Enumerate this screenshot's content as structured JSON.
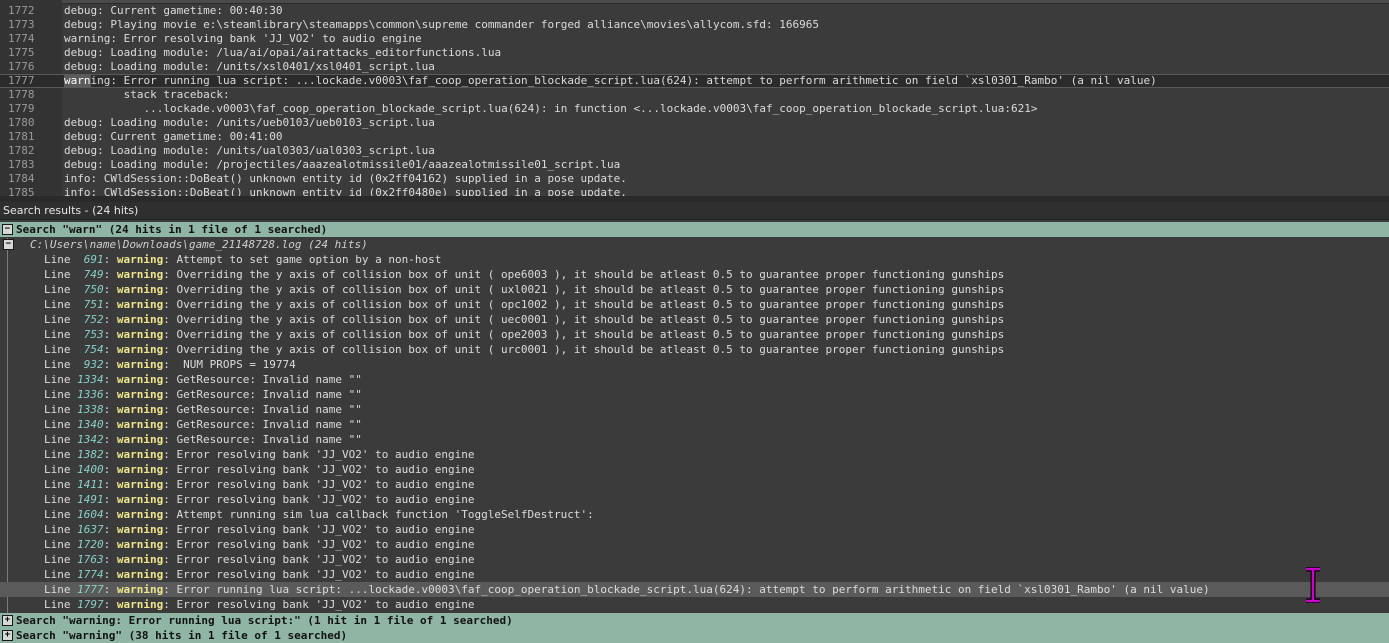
{
  "editor": {
    "lines": [
      {
        "num": "1772",
        "text": "debug: Current gametime: 00:40:30"
      },
      {
        "num": "1773",
        "text": "debug: Playing movie e:\\steamlibrary\\steamapps\\common\\supreme commander forged alliance\\movies\\allycom.sfd: 166965"
      },
      {
        "num": "1774",
        "text": "warning: Error resolving bank 'JJ_VO2' to audio engine"
      },
      {
        "num": "1775",
        "text": "debug: Loading module: /lua/ai/opai/airattacks_editorfunctions.lua"
      },
      {
        "num": "1776",
        "text": "debug: Loading module: /units/xsl0401/xsl0401_script.lua"
      },
      {
        "num": "1777",
        "hl": "warn",
        "text": "ing: Error running lua script: ...lockade.v0003\\faf_coop_operation_blockade_script.lua(624): attempt to perform arithmetic on field `xsl0301_Rambo' (a nil value)"
      },
      {
        "num": "1778",
        "text": "         stack traceback:"
      },
      {
        "num": "1779",
        "text": "            ...lockade.v0003\\faf_coop_operation_blockade_script.lua(624): in function <...lockade.v0003\\faf_coop_operation_blockade_script.lua:621>"
      },
      {
        "num": "1780",
        "text": "debug: Loading module: /units/ueb0103/ueb0103_script.lua"
      },
      {
        "num": "1781",
        "text": "debug: Current gametime: 00:41:00"
      },
      {
        "num": "1782",
        "text": "debug: Loading module: /units/ual0303/ual0303_script.lua"
      },
      {
        "num": "1783",
        "text": "debug: Loading module: /projectiles/aaazealotmissile01/aaazealotmissile01_script.lua"
      },
      {
        "num": "1784",
        "text": "info: CWldSession::DoBeat() unknown entity id (0x2ff04162) supplied in a pose update."
      },
      {
        "num": "1785",
        "text": "info: CWldSession::DoBeat() unknown entity id (0x2ff0480e) supplied in a pose update."
      }
    ]
  },
  "search_panel": {
    "header": "Search results - (24 hits)",
    "search_title": "Search \"warn\" (24 hits in 1 file of 1 searched)",
    "file": "C:\\Users\\name\\Downloads\\game_21148728.log (24 hits)",
    "line_word": "Line",
    "hits": [
      {
        "num": " 691",
        "kw": "warning",
        "text": ": Attempt to set game option by a non-host"
      },
      {
        "num": " 749",
        "kw": "warning",
        "text": ": Overriding the y axis of collision box of unit ( ope6003 ), it should be atleast 0.5 to guarantee proper functioning gunships"
      },
      {
        "num": " 750",
        "kw": "warning",
        "text": ": Overriding the y axis of collision box of unit ( uxl0021 ), it should be atleast 0.5 to guarantee proper functioning gunships"
      },
      {
        "num": " 751",
        "kw": "warning",
        "text": ": Overriding the y axis of collision box of unit ( opc1002 ), it should be atleast 0.5 to guarantee proper functioning gunships"
      },
      {
        "num": " 752",
        "kw": "warning",
        "text": ": Overriding the y axis of collision box of unit ( uec0001 ), it should be atleast 0.5 to guarantee proper functioning gunships"
      },
      {
        "num": " 753",
        "kw": "warning",
        "text": ": Overriding the y axis of collision box of unit ( ope2003 ), it should be atleast 0.5 to guarantee proper functioning gunships"
      },
      {
        "num": " 754",
        "kw": "warning",
        "text": ": Overriding the y axis of collision box of unit ( urc0001 ), it should be atleast 0.5 to guarantee proper functioning gunships"
      },
      {
        "num": " 932",
        "kw": "warning",
        "text": ":  NUM PROPS = 19774"
      },
      {
        "num": "1334",
        "kw": "warning",
        "text": ": GetResource: Invalid name \"\""
      },
      {
        "num": "1336",
        "kw": "warning",
        "text": ": GetResource: Invalid name \"\""
      },
      {
        "num": "1338",
        "kw": "warning",
        "text": ": GetResource: Invalid name \"\""
      },
      {
        "num": "1340",
        "kw": "warning",
        "text": ": GetResource: Invalid name \"\""
      },
      {
        "num": "1342",
        "kw": "warning",
        "text": ": GetResource: Invalid name \"\""
      },
      {
        "num": "1382",
        "kw": "warning",
        "text": ": Error resolving bank 'JJ_VO2' to audio engine"
      },
      {
        "num": "1400",
        "kw": "warning",
        "text": ": Error resolving bank 'JJ_VO2' to audio engine"
      },
      {
        "num": "1411",
        "kw": "warning",
        "text": ": Error resolving bank 'JJ_VO2' to audio engine"
      },
      {
        "num": "1491",
        "kw": "warning",
        "text": ": Error resolving bank 'JJ_VO2' to audio engine"
      },
      {
        "num": "1604",
        "kw": "warning",
        "text": ": Attempt running sim lua callback function 'ToggleSelfDestruct':"
      },
      {
        "num": "1637",
        "kw": "warning",
        "text": ": Error resolving bank 'JJ_VO2' to audio engine"
      },
      {
        "num": "1720",
        "kw": "warning",
        "text": ": Error resolving bank 'JJ_VO2' to audio engine"
      },
      {
        "num": "1763",
        "kw": "warning",
        "text": ": Error resolving bank 'JJ_VO2' to audio engine"
      },
      {
        "num": "1774",
        "kw": "warning",
        "text": ": Error resolving bank 'JJ_VO2' to audio engine"
      },
      {
        "num": "1777",
        "kw": "warning",
        "text": ": Error running lua script: ...lockade.v0003\\faf_coop_operation_blockade_script.lua(624): attempt to perform arithmetic on field `xsl0301_Rambo' (a nil value)",
        "selected": true
      },
      {
        "num": "1797",
        "kw": "warning",
        "text": ": Error resolving bank 'JJ_VO2' to audio engine"
      }
    ],
    "footer_searches": [
      "Search \"warning: Error running lua script:\" (1 hit in 1 file of 1 searched)",
      "Search \"warning\" (38 hits in 1 file of 1 searched)"
    ],
    "expand_symbol": "+",
    "collapse_symbol": "−"
  },
  "colors": {
    "search_title_bg": "#8fb6a4",
    "keyword": "#f0e68c",
    "line_number": "#8ad0c8",
    "cursor": "#cc00cc"
  }
}
